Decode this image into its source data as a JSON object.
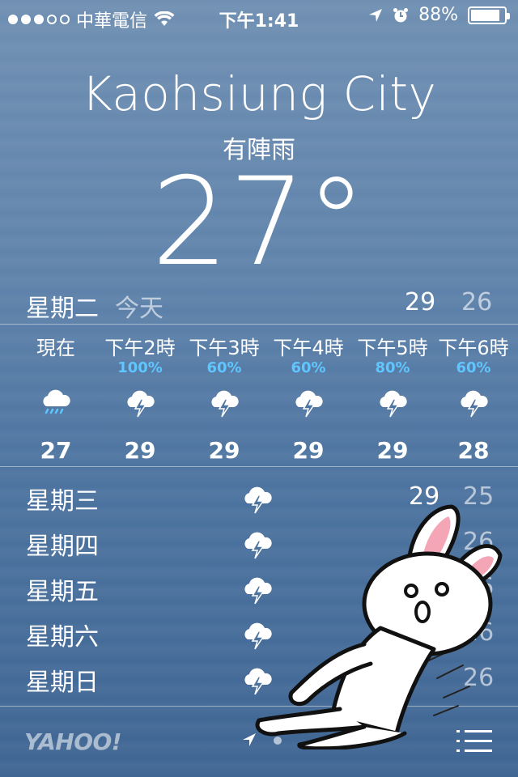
{
  "status_bar": {
    "signal_bars_filled": 3,
    "signal_bars_total": 5,
    "carrier": "中華電信",
    "time": "下午1:41",
    "battery_pct": "88%",
    "battery_level": 0.88,
    "icons": [
      "wifi-icon",
      "location-arrow-icon",
      "alarm-icon",
      "battery-icon"
    ]
  },
  "weather": {
    "city": "Kaohsiung City",
    "condition": "有陣雨",
    "temperature": "27°"
  },
  "today": {
    "day": "星期二",
    "label": "今天",
    "high": "29",
    "low": "26"
  },
  "hourly": [
    {
      "time": "現在",
      "precip": "",
      "icon": "rain-cloud-icon",
      "temp": "27"
    },
    {
      "time": "下午2時",
      "precip": "100%",
      "icon": "thunderstorm-icon",
      "temp": "29"
    },
    {
      "time": "下午3時",
      "precip": "60%",
      "icon": "thunderstorm-icon",
      "temp": "29"
    },
    {
      "time": "下午4時",
      "precip": "60%",
      "icon": "thunderstorm-icon",
      "temp": "29"
    },
    {
      "time": "下午5時",
      "precip": "80%",
      "icon": "thunderstorm-icon",
      "temp": "29"
    },
    {
      "time": "下午6時",
      "precip": "60%",
      "icon": "thunderstorm-icon",
      "temp": "28"
    }
  ],
  "daily": [
    {
      "day": "星期三",
      "icon": "thunderstorm-icon",
      "high": "29",
      "low": "25"
    },
    {
      "day": "星期四",
      "icon": "thunderstorm-icon",
      "high": "",
      "low": "26"
    },
    {
      "day": "星期五",
      "icon": "thunderstorm-icon",
      "high": "",
      "low": "26"
    },
    {
      "day": "星期六",
      "icon": "thunderstorm-icon",
      "high": "",
      "low": "26"
    },
    {
      "day": "星期日",
      "icon": "thunderstorm-icon",
      "high": "",
      "low": "26"
    }
  ],
  "footer": {
    "brand": "YAHOO!",
    "icons": [
      "location-arrow-icon",
      "list-icon"
    ]
  },
  "colors": {
    "precip_text": "#5fc6ff",
    "background_top": "#6f8fb2",
    "background_bottom": "#3f6593"
  }
}
